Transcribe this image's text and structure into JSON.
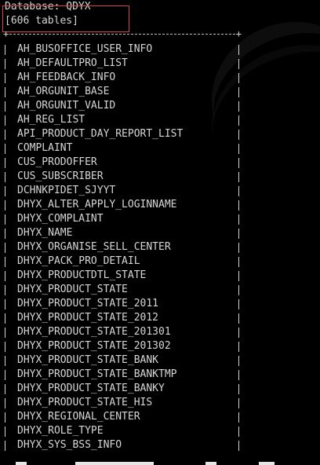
{
  "terminal": {
    "database_line": "Database: QDYX",
    "count_line": "606 tables]",
    "count_prefix": "[",
    "border_corner": "+"
  },
  "tables": [
    "AH_BUSOFFICE_USER_INFO",
    "AH_DEFAULTPRO_LIST",
    "AH_FEEDBACK_INFO",
    "AH_ORGUNIT_BASE",
    "AH_ORGUNIT_VALID",
    "AH_REG_LIST",
    "API_PRODUCT_DAY_REPORT_LIST",
    "COMPLAINT",
    "CUS_PRODOFFER",
    "CUS_SUBSCRIBER",
    "DCHNKPIDET_SJYYT",
    "DHYX_ALTER_APPLY_LOGINNAME",
    "DHYX_COMPLAINT",
    "DHYX_NAME",
    "DHYX_ORGANISE_SELL_CENTER",
    "DHYX_PACK_PRO_DETAIL",
    "DHYX_PRODUCTDTL_STATE",
    "DHYX_PRODUCT_STATE",
    "DHYX_PRODUCT_STATE_2011",
    "DHYX_PRODUCT_STATE_2012",
    "DHYX_PRODUCT_STATE_201301",
    "DHYX_PRODUCT_STATE_201302",
    "DHYX_PRODUCT_STATE_BANK",
    "DHYX_PRODUCT_STATE_BANKTMP",
    "DHYX_PRODUCT_STATE_BANKY",
    "DHYX_PRODUCT_STATE_HIS",
    "DHYX_REGIONAL_CENTER",
    "DHYX_ROLE_TYPE",
    "DHYX_SYS_BSS_INFO"
  ],
  "colors": {
    "background": "#000000",
    "text": "#d6d6d6",
    "highlight": "#d64545"
  }
}
